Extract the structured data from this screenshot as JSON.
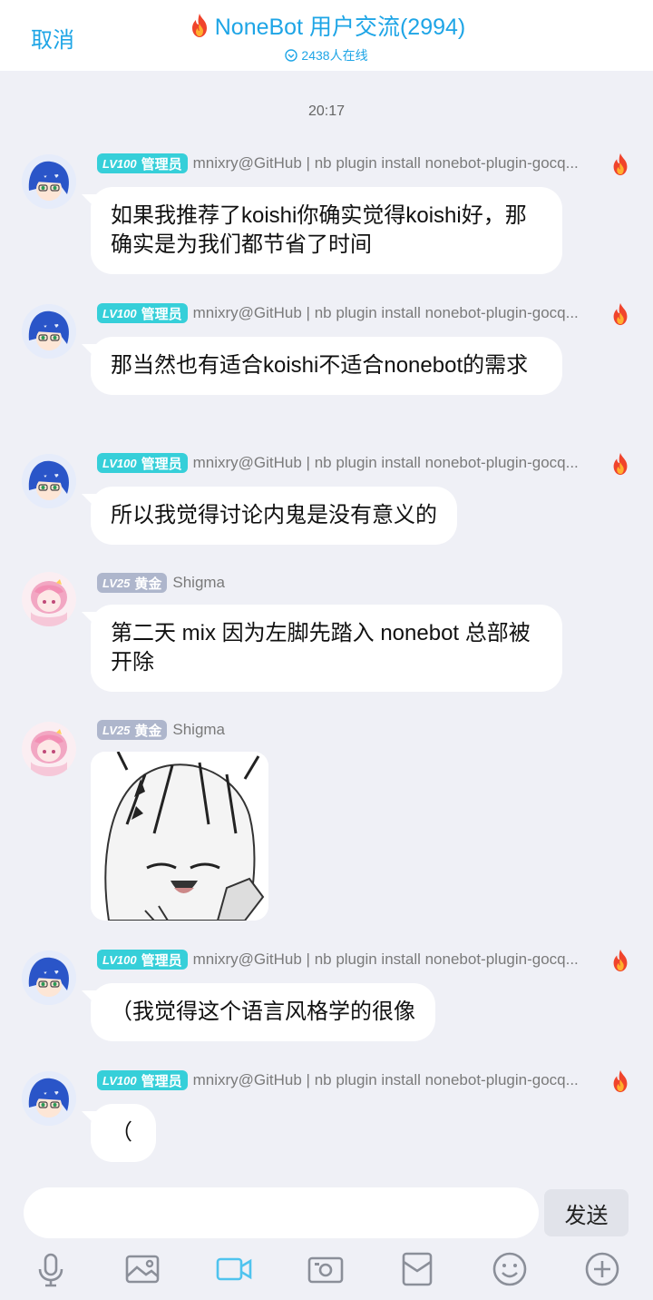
{
  "header": {
    "cancel_label": "取消",
    "group_name": "NoneBot 用户交流(2994)",
    "online_text": "2438人在线"
  },
  "time_divider": "20:17",
  "messages": [
    {
      "sender": "mnixry@GitHub | nb plugin install nonebot-plugin-gocq...",
      "level": "LV100",
      "role": "管理员",
      "text": "如果我推荐了koishi你确实觉得koishi好，那确实是为我们都节省了时间"
    },
    {
      "sender": "mnixry@GitHub | nb plugin install nonebot-plugin-gocq...",
      "level": "LV100",
      "role": "管理员",
      "text": "那当然也有适合koishi不适合nonebot的需求"
    },
    {
      "sender": "mnixry@GitHub | nb plugin install nonebot-plugin-gocq...",
      "level": "LV100",
      "role": "管理员",
      "text": "所以我觉得讨论内鬼是没有意义的"
    },
    {
      "sender": "Shigma",
      "level": "LV25",
      "role": "黄金",
      "text": "第二天 mix 因为左脚先踏入 nonebot 总部被开除"
    },
    {
      "sender": "Shigma",
      "level": "LV25",
      "role": "黄金",
      "image": "anime-sticker-image"
    },
    {
      "sender": "mnixry@GitHub | nb plugin install nonebot-plugin-gocq...",
      "level": "LV100",
      "role": "管理员",
      "text": "（我觉得这个语言风格学的很像"
    },
    {
      "sender": "mnixry@GitHub | nb plugin install nonebot-plugin-gocq...",
      "level": "LV100",
      "role": "管理员",
      "text": "（"
    }
  ],
  "composer": {
    "send_label": "发送"
  },
  "toolbar": [
    "microphone-icon",
    "photo-icon",
    "video-icon",
    "camera-icon",
    "red-packet-icon",
    "emoji-icon",
    "plus-icon"
  ],
  "colors": {
    "accent": "#1ea5e6",
    "admin_badge": "#36cfd9",
    "gold_badge": "#aeb6cc",
    "background": "#eff0f6"
  }
}
